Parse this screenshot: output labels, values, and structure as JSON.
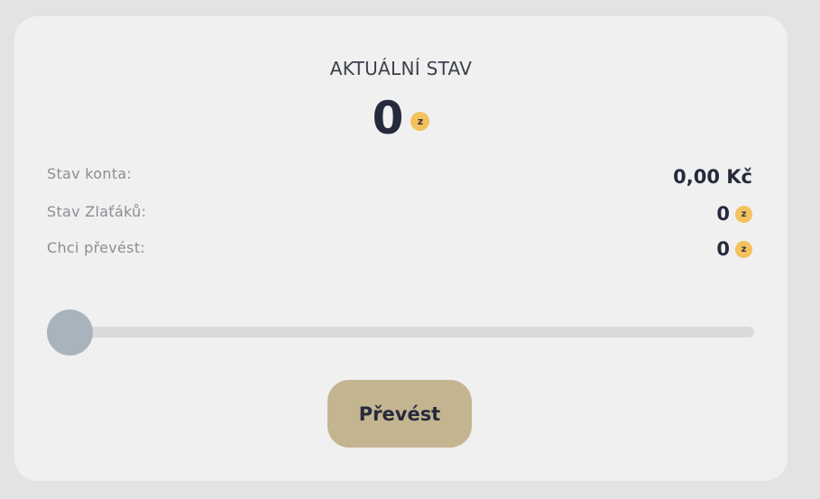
{
  "header": {
    "title": "AKTUÁLNÍ STAV",
    "balance": "0"
  },
  "currency_icon": {
    "name": "zlatak-coin-icon",
    "glyph": "z",
    "color": "#f3c15d"
  },
  "rows": [
    {
      "label": "Stav konta:",
      "value": "0,00 Kč"
    },
    {
      "label": "Stav Zlaťáků:",
      "value": "0"
    },
    {
      "label": "Chci převést:",
      "value": "0"
    }
  ],
  "slider": {
    "value_fraction": 0
  },
  "submit": {
    "label": "Převést",
    "color": "#c4b591"
  }
}
